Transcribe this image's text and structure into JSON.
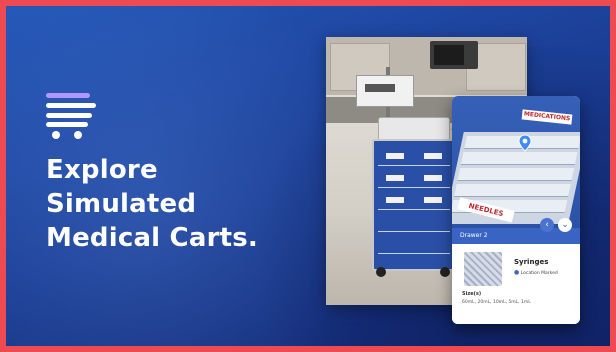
{
  "hero": {
    "headline_lines": [
      "Explore",
      "Simulated",
      "Medical Carts."
    ]
  },
  "ar_view": {
    "medications_label": "MEDICATIONS",
    "needles_label": "NEEDLES",
    "prev_icon": "chevron-left-icon",
    "next_icon": "chevron-down-icon"
  },
  "detail_sheet": {
    "title": "Drawer 2",
    "item_name": "Syringes",
    "item_location": "Location Marked",
    "sizes_label": "Size(s)",
    "sizes_value": "60mL, 20mL, 10mL, 5mL, 1mL"
  },
  "colors": {
    "background_blue": "#1b3f97",
    "frame_border": "#ee4a52",
    "logo_accent": "#b196ff",
    "sheet_header": "#3a64c4"
  }
}
